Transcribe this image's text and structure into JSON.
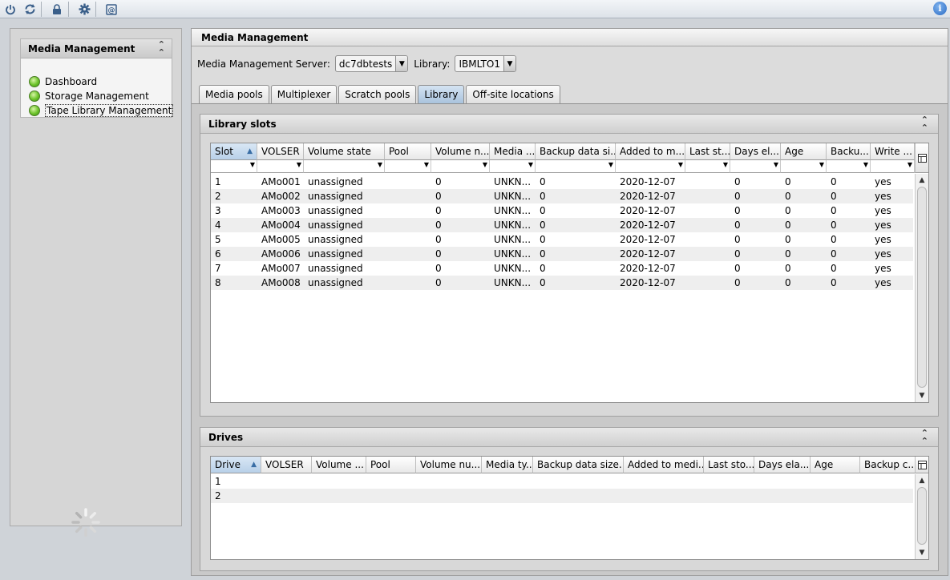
{
  "toolbar": {
    "icons": [
      "power-icon",
      "refresh-icon",
      "lock-icon",
      "gear-icon",
      "console-icon",
      "info-icon"
    ],
    "info_label": "i"
  },
  "left_panel": {
    "title": "Media Management",
    "nav": [
      {
        "label": "Dashboard",
        "status": "green"
      },
      {
        "label": "Storage Management",
        "status": "green"
      },
      {
        "label": "Tape Library Management",
        "status": "green",
        "selected": true
      }
    ]
  },
  "main": {
    "title": "Media Management",
    "server_label": "Media Management Server:",
    "server_value": "dc7dbtests",
    "library_label": "Library:",
    "library_value": "IBMLTO1",
    "tabs": [
      {
        "label": "Media pools"
      },
      {
        "label": "Multiplexer"
      },
      {
        "label": "Scratch pools"
      },
      {
        "label": "Library",
        "selected": true
      },
      {
        "label": "Off-site locations"
      }
    ]
  },
  "library_slots": {
    "title": "Library slots",
    "columns": [
      "Slot",
      "VOLSER",
      "Volume state",
      "Pool",
      "Volume n...",
      "Media ...",
      "Backup data si...",
      "Added to m...",
      "Last st...",
      "Days el...",
      "Age",
      "Backu...",
      "Write ..."
    ],
    "rows": [
      [
        "1",
        "AMo001",
        "unassigned",
        "",
        "0",
        "UNKN...",
        "0",
        "2020-12-07",
        "",
        "0",
        "0",
        "0",
        "yes"
      ],
      [
        "2",
        "AMo002",
        "unassigned",
        "",
        "0",
        "UNKN...",
        "0",
        "2020-12-07",
        "",
        "0",
        "0",
        "0",
        "yes"
      ],
      [
        "3",
        "AMo003",
        "unassigned",
        "",
        "0",
        "UNKN...",
        "0",
        "2020-12-07",
        "",
        "0",
        "0",
        "0",
        "yes"
      ],
      [
        "4",
        "AMo004",
        "unassigned",
        "",
        "0",
        "UNKN...",
        "0",
        "2020-12-07",
        "",
        "0",
        "0",
        "0",
        "yes"
      ],
      [
        "5",
        "AMo005",
        "unassigned",
        "",
        "0",
        "UNKN...",
        "0",
        "2020-12-07",
        "",
        "0",
        "0",
        "0",
        "yes"
      ],
      [
        "6",
        "AMo006",
        "unassigned",
        "",
        "0",
        "UNKN...",
        "0",
        "2020-12-07",
        "",
        "0",
        "0",
        "0",
        "yes"
      ],
      [
        "7",
        "AMo007",
        "unassigned",
        "",
        "0",
        "UNKN...",
        "0",
        "2020-12-07",
        "",
        "0",
        "0",
        "0",
        "yes"
      ],
      [
        "8",
        "AMo008",
        "unassigned",
        "",
        "0",
        "UNKN...",
        "0",
        "2020-12-07",
        "",
        "0",
        "0",
        "0",
        "yes"
      ]
    ]
  },
  "drives": {
    "title": "Drives",
    "columns": [
      "Drive",
      "VOLSER",
      "Volume ...",
      "Pool",
      "Volume nu...",
      "Media ty...",
      "Backup data size...",
      "Added to medi...",
      "Last sto...",
      "Days ela...",
      "Age",
      "Backup c..."
    ],
    "rows": [
      [
        "1"
      ],
      [
        "2"
      ]
    ]
  }
}
